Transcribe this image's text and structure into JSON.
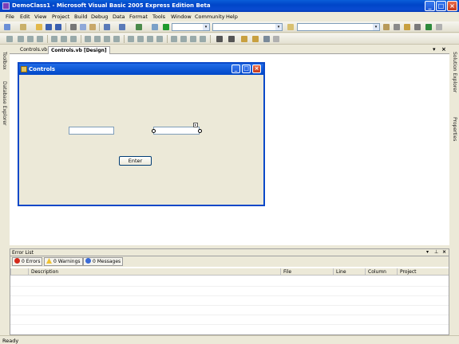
{
  "window": {
    "title": "DemoClass1 - Microsoft Visual Basic 2005 Express Edition Beta",
    "minimize": "_",
    "maximize": "□",
    "close": "×"
  },
  "menu": [
    "File",
    "Edit",
    "View",
    "Project",
    "Build",
    "Debug",
    "Data",
    "Format",
    "Tools",
    "Window",
    "Community",
    "Help"
  ],
  "left_dock": {
    "toolbox": "Toolbox",
    "database_explorer": "Database Explorer"
  },
  "right_dock": {
    "solution_explorer": "Solution Explorer",
    "properties": "Properties"
  },
  "document_tabs": [
    {
      "label": "Controls.vb",
      "active": false
    },
    {
      "label": "Controls.vb [Design]",
      "active": true
    }
  ],
  "doc_controls": {
    "dropdown": "▾",
    "close": "×"
  },
  "designer_form": {
    "title": "Controls",
    "button_label": "Enter",
    "smart_tag": "▸"
  },
  "error_list": {
    "title": "Error List",
    "filters": {
      "errors": "0 Errors",
      "warnings": "0 Warnings",
      "messages": "0 Messages"
    },
    "columns": [
      "Description",
      "File",
      "Line",
      "Column",
      "Project"
    ],
    "panel_controls": {
      "dropdown": "▾",
      "pin": "⊥",
      "close": "×"
    }
  },
  "status": {
    "text": "Ready"
  },
  "colors": {
    "title_blue": "#0045c8",
    "error_red": "#d42a1c",
    "warning_yellow": "#f1c232",
    "info_blue": "#3b6bd6"
  }
}
